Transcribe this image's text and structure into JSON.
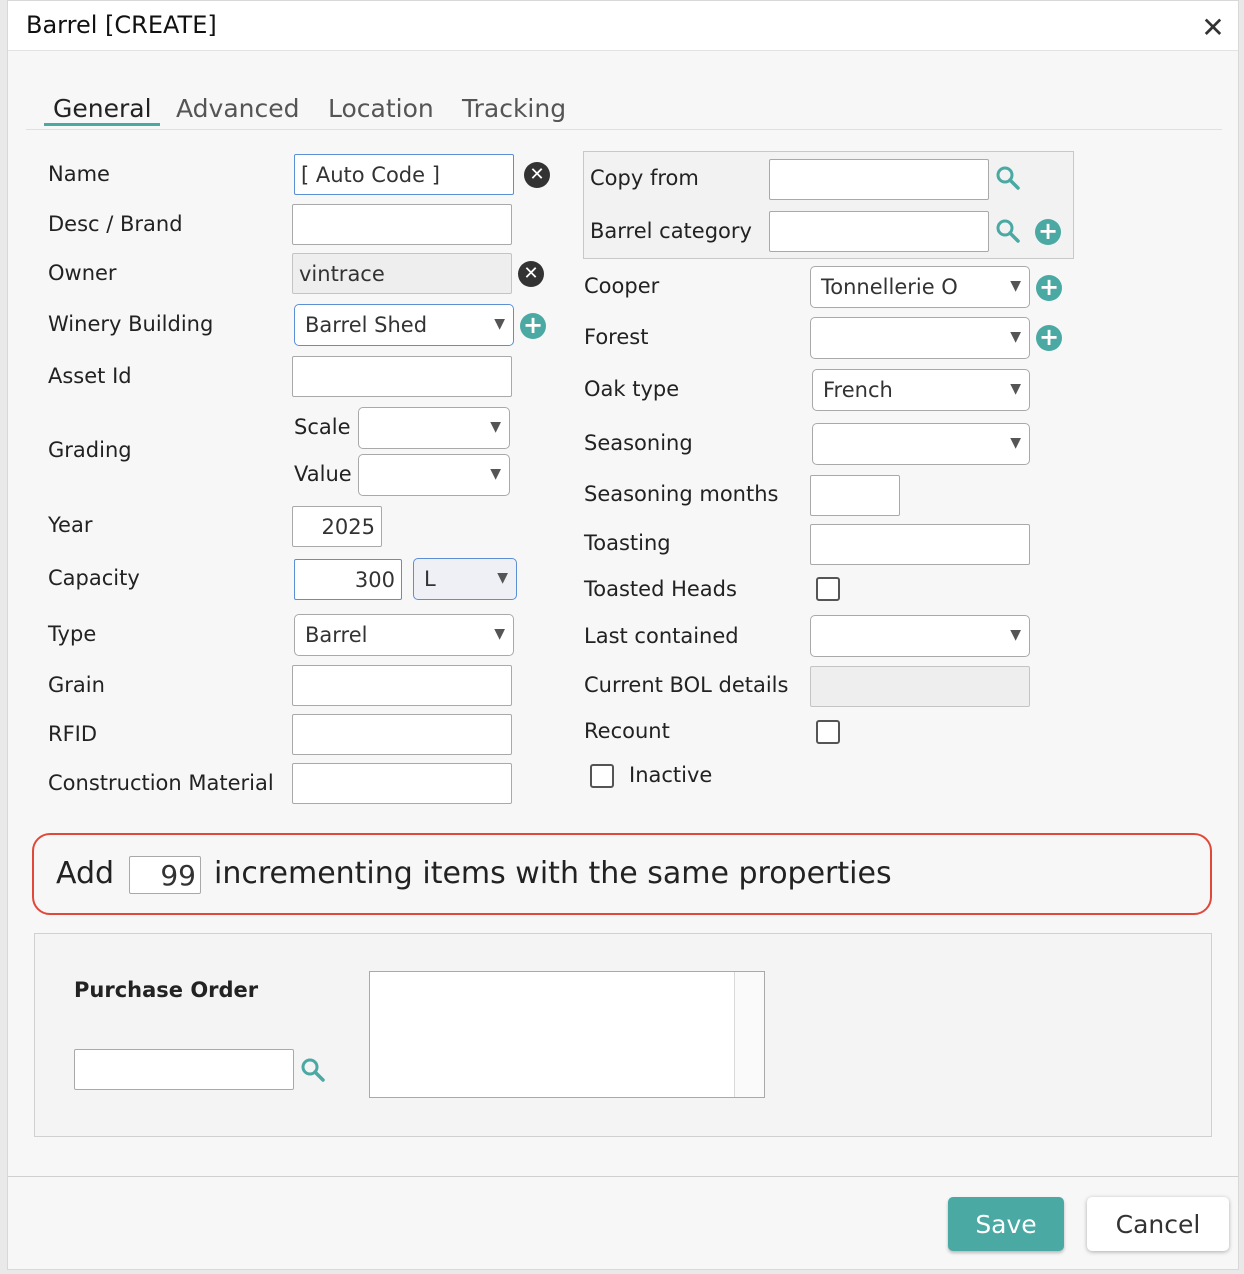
{
  "dialog": {
    "title": "Barrel [CREATE]",
    "close_glyph": "✕"
  },
  "tabs": [
    "General",
    "Advanced",
    "Location",
    "Tracking"
  ],
  "left": {
    "name": {
      "label": "Name",
      "value": "[ Auto Code ]"
    },
    "desc": {
      "label": "Desc / Brand",
      "value": ""
    },
    "owner": {
      "label": "Owner",
      "value": "vintrace"
    },
    "winery": {
      "label": "Winery Building",
      "value": "Barrel Shed"
    },
    "asset": {
      "label": "Asset Id",
      "value": ""
    },
    "grading": {
      "label": "Grading",
      "scale_label": "Scale",
      "scale_value": "",
      "value_label": "Value",
      "value_value": ""
    },
    "year": {
      "label": "Year",
      "value": "2025"
    },
    "capacity": {
      "label": "Capacity",
      "value": "300",
      "unit": "L"
    },
    "type": {
      "label": "Type",
      "value": "Barrel"
    },
    "grain": {
      "label": "Grain",
      "value": ""
    },
    "rfid": {
      "label": "RFID",
      "value": ""
    },
    "construction": {
      "label": "Construction Material",
      "value": ""
    }
  },
  "right": {
    "copy_from": {
      "label": "Copy from",
      "value": ""
    },
    "category": {
      "label": "Barrel category",
      "value": ""
    },
    "cooper": {
      "label": "Cooper",
      "value": "Tonnellerie O"
    },
    "forest": {
      "label": "Forest",
      "value": ""
    },
    "oak": {
      "label": "Oak type",
      "value": "French"
    },
    "seasoning": {
      "label": "Seasoning",
      "value": ""
    },
    "seasoning_months": {
      "label": "Seasoning months",
      "value": ""
    },
    "toasting": {
      "label": "Toasting",
      "value": ""
    },
    "toasted_heads": {
      "label": "Toasted Heads",
      "checked": false
    },
    "last_contained": {
      "label": "Last contained",
      "value": ""
    },
    "bol": {
      "label": "Current BOL details",
      "value": ""
    },
    "recount": {
      "label": "Recount",
      "checked": false
    },
    "inactive": {
      "label": "Inactive",
      "checked": false
    }
  },
  "add_items": {
    "prefix": "Add",
    "count": "99",
    "suffix": "incrementing items with the same properties"
  },
  "purchase_order": {
    "label": "Purchase Order",
    "search_value": ""
  },
  "footer": {
    "save": "Save",
    "cancel": "Cancel"
  },
  "icons": {
    "dropdown": "▼",
    "clear": "✕",
    "add": "+"
  },
  "colors": {
    "accent": "#4aa9a3",
    "highlight_border": "#e0483a",
    "focus_border": "#5b8fd6"
  }
}
